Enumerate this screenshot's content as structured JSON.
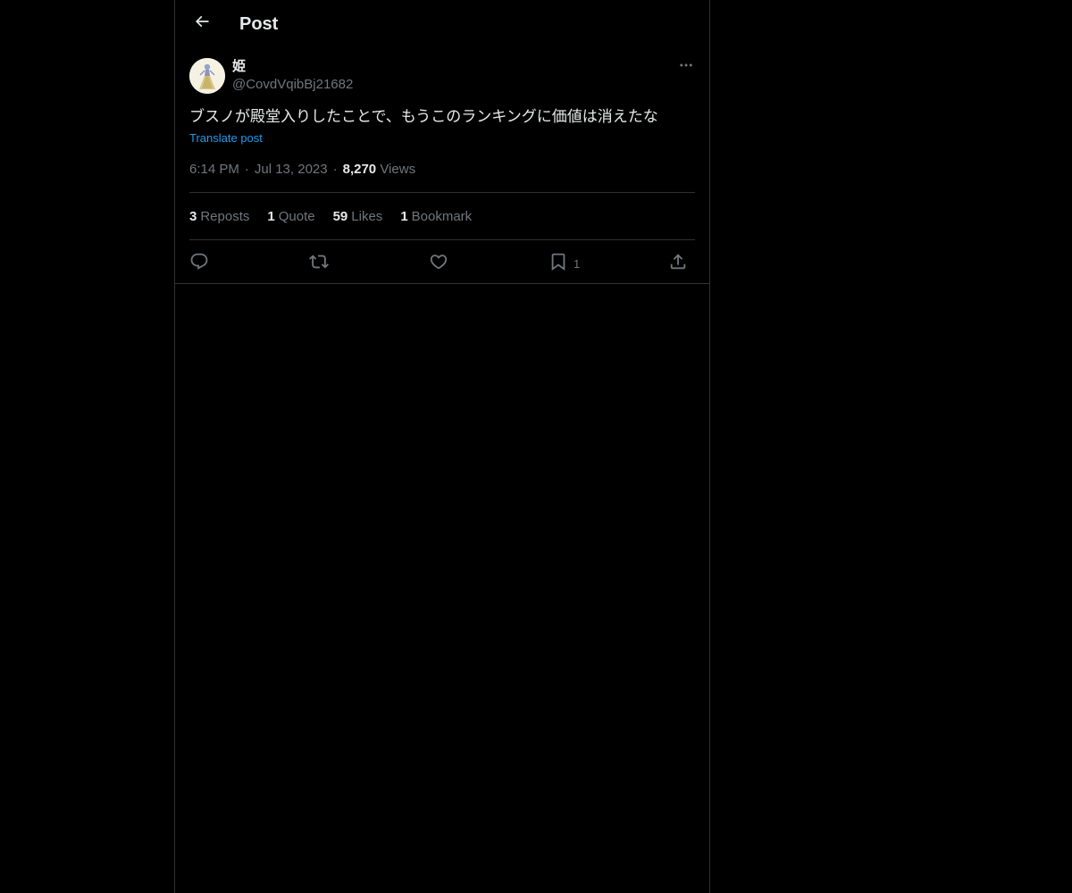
{
  "header": {
    "title": "Post"
  },
  "post": {
    "display_name": "姫",
    "handle": "@CovdVqibBj21682",
    "text": "ブスノが殿堂入りしたことで、もうこのランキングに価値は消えたな",
    "translate_label": "Translate post",
    "time": "6:14 PM",
    "date": "Jul 13, 2023",
    "views_count": "8,270",
    "views_label": "Views"
  },
  "stats": {
    "reposts_count": "3",
    "reposts_label": "Reposts",
    "quotes_count": "1",
    "quotes_label": "Quote",
    "likes_count": "59",
    "likes_label": "Likes",
    "bookmarks_count": "1",
    "bookmarks_label": "Bookmark"
  },
  "actions": {
    "bookmark_count": "1"
  },
  "colors": {
    "background": "#000000",
    "text_primary": "#e7e9ea",
    "text_secondary": "#71767b",
    "link": "#1d9bf0",
    "border": "#2f3336"
  }
}
